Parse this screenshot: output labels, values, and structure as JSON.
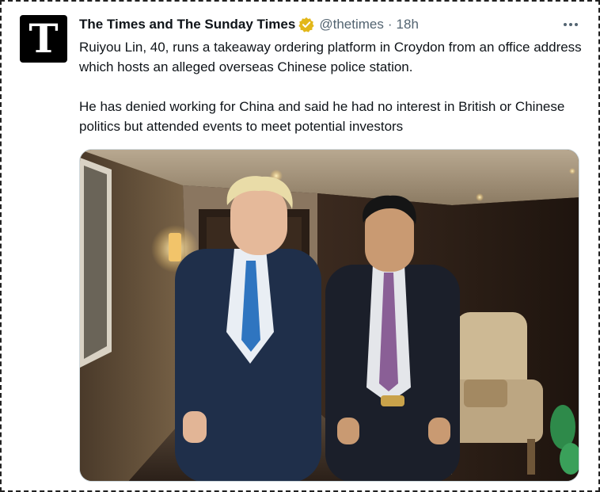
{
  "tweet": {
    "author_name": "The Times and The Sunday Times",
    "handle": "@thetimes",
    "separator": "·",
    "time": "18h",
    "avatar_letter": "T",
    "verified_icon": "gold-verified-badge-icon",
    "more_icon": "more-dots-icon",
    "paragraphs": [
      "Ruiyou Lin, 40, runs a takeaway ordering platform in Croydon from an office address which hosts an alleged overseas Chinese police station.",
      "He has denied working for China and said he had no interest in British or Chinese politics but attended events to meet potential investors"
    ],
    "colors": {
      "verified": "#e2b719",
      "text": "#0f1419",
      "secondary": "#536471"
    }
  }
}
